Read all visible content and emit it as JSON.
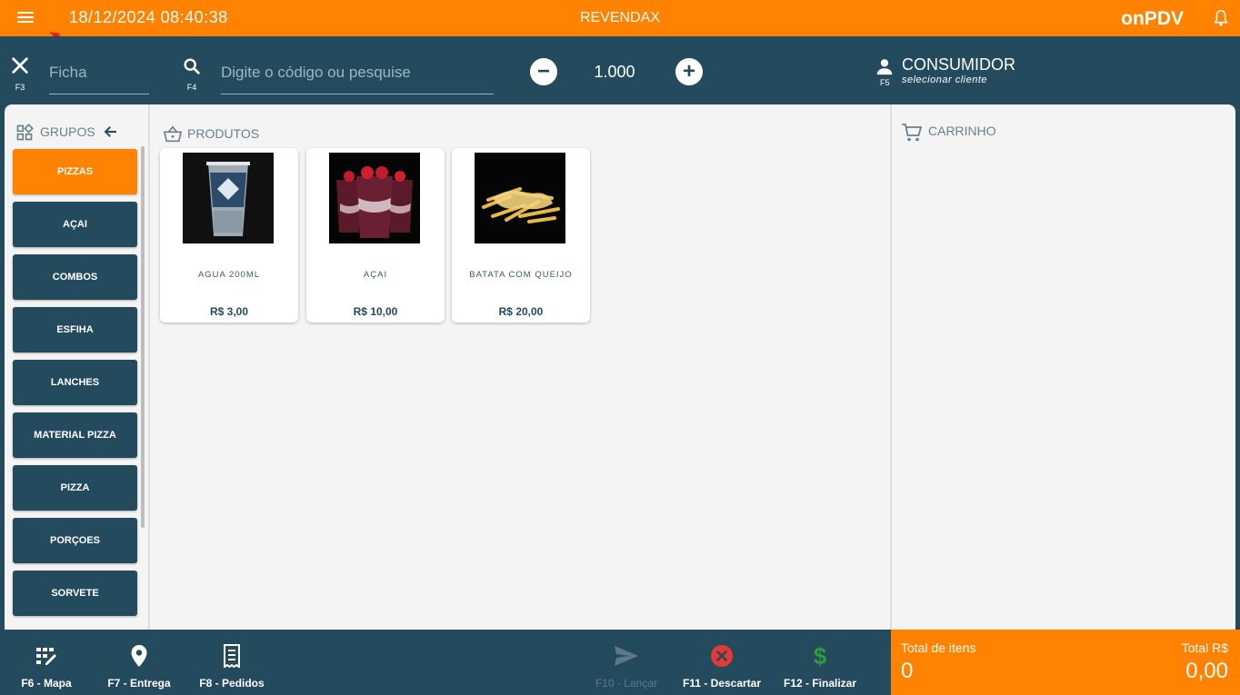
{
  "topbar": {
    "datetime": "18/12/2024 08:40:38",
    "store_name": "REVENDAX",
    "brand": "onPDV"
  },
  "toolbar": {
    "ficha_key": "F3",
    "ficha_placeholder": "Ficha",
    "search_key": "F4",
    "search_placeholder": "Digite o código ou pesquise",
    "quantity": "1.000",
    "customer_key": "F5",
    "customer_title": "CONSUMIDOR",
    "customer_subtitle": "selecionar cliente"
  },
  "groups": {
    "title": "GRUPOS",
    "items": [
      {
        "label": "PIZZAS",
        "active": true
      },
      {
        "label": "AÇAI"
      },
      {
        "label": "COMBOS"
      },
      {
        "label": "ESFIHA"
      },
      {
        "label": "LANCHES"
      },
      {
        "label": "MATERIAL PIZZA"
      },
      {
        "label": "PIZZA"
      },
      {
        "label": "PORÇOES"
      },
      {
        "label": "SORVETE"
      }
    ]
  },
  "products": {
    "title": "PRODUTOS",
    "items": [
      {
        "name": "AGUA 200ML",
        "price": "R$ 3,00"
      },
      {
        "name": "AÇAI",
        "price": "R$ 10,00"
      },
      {
        "name": "BATATA COM QUEIJO",
        "price": "R$ 20,00"
      }
    ]
  },
  "cart": {
    "title": "CARRINHO"
  },
  "bottombar": {
    "map": "F6 - Mapa",
    "delivery": "F7 - Entrega",
    "orders": "F8 - Pedidos",
    "launch": "F10 - Lançar",
    "discard": "F11 - Descartar",
    "finish": "F12 - Finalizar"
  },
  "totals": {
    "items_label": "Total de itens",
    "items_value": "0",
    "amount_label": "Total R$",
    "amount_value": "0,00"
  },
  "colors": {
    "accent": "#ff8200",
    "primary": "#244a5e",
    "background": "#f4f4f4",
    "discard": "#e53935",
    "finish": "#2e9d3a"
  }
}
